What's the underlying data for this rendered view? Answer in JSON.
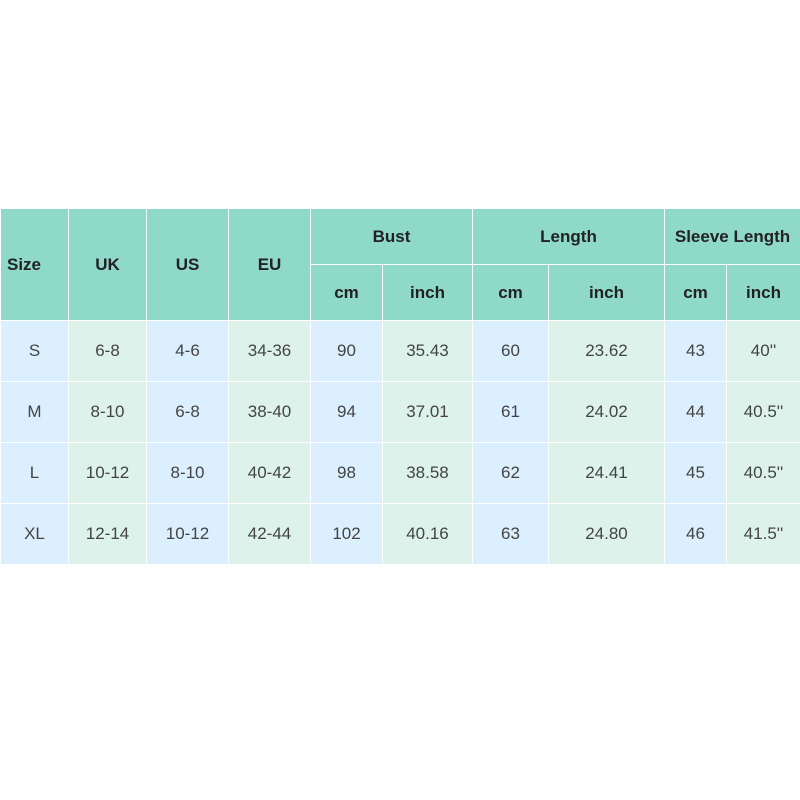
{
  "header": {
    "size": "Size",
    "uk": "UK",
    "us": "US",
    "eu": "EU",
    "groups": [
      {
        "label": "Bust",
        "units": [
          "cm",
          "inch"
        ]
      },
      {
        "label": "Length",
        "units": [
          "cm",
          "inch"
        ]
      },
      {
        "label": "Sleeve Length",
        "units": [
          "cm",
          "inch"
        ]
      }
    ]
  },
  "rows": [
    {
      "size": "S",
      "uk": "6-8",
      "us": "4-6",
      "eu": "34-36",
      "bust_cm": "90",
      "bust_inch": "35.43",
      "length_cm": "60",
      "length_inch": "23.62",
      "sleeve_cm": "43",
      "sleeve_inch": "40''"
    },
    {
      "size": "M",
      "uk": "8-10",
      "us": "6-8",
      "eu": "38-40",
      "bust_cm": "94",
      "bust_inch": "37.01",
      "length_cm": "61",
      "length_inch": "24.02",
      "sleeve_cm": "44",
      "sleeve_inch": "40.5''"
    },
    {
      "size": "L",
      "uk": "10-12",
      "us": "8-10",
      "eu": "40-42",
      "bust_cm": "98",
      "bust_inch": "38.58",
      "length_cm": "62",
      "length_inch": "24.41",
      "sleeve_cm": "45",
      "sleeve_inch": "40.5''"
    },
    {
      "size": "XL",
      "uk": "12-14",
      "us": "10-12",
      "eu": "42-44",
      "bust_cm": "102",
      "bust_inch": "40.16",
      "length_cm": "63",
      "length_inch": "24.80",
      "sleeve_cm": "46",
      "sleeve_inch": "41.5''"
    }
  ],
  "colors": {
    "header_bg": "#8fd9c8",
    "cell_blue": "#dcefff",
    "cell_green": "#dcf2eb"
  }
}
